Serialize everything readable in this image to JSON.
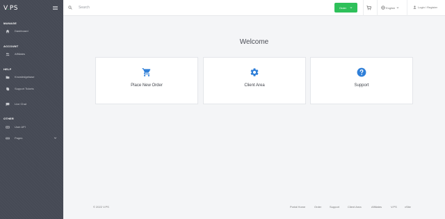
{
  "brand": {
    "logo_v": "V",
    "logo_dot": ".",
    "logo_ps": "PS"
  },
  "sidebar": {
    "sections": [
      {
        "title": "MANAGE",
        "items": [
          {
            "label": "Dashboard",
            "icon": "home-icon"
          }
        ]
      },
      {
        "title": "ACCOUNT",
        "items": [
          {
            "label": "Affiliates",
            "icon": "users-icon"
          }
        ]
      },
      {
        "title": "HELP",
        "items": [
          {
            "label": "Knowledgebase",
            "icon": "folder-icon"
          },
          {
            "label": "Support Tickets",
            "icon": "tickets-icon"
          },
          {
            "label": "Live Chat",
            "icon": "chat-icon"
          }
        ]
      },
      {
        "title": "OTHER",
        "items": [
          {
            "label": "User API",
            "icon": "api-icon"
          },
          {
            "label": "Pages",
            "icon": "pages-icon"
          }
        ]
      }
    ]
  },
  "topbar": {
    "search_placeholder": "Search",
    "order_label": "Order",
    "language_label": "English",
    "login_label": "Login / Register"
  },
  "main": {
    "welcome": "Welcome",
    "cards": [
      {
        "label": "Place New Order",
        "icon": "cart-icon"
      },
      {
        "label": "Client Area",
        "icon": "gear-icon"
      },
      {
        "label": "Support",
        "icon": "help-icon"
      }
    ]
  },
  "footer": {
    "copyright": "© 2022 V.PS",
    "links": [
      "Portal Home",
      "Order",
      "Support",
      "Client Area",
      "Affiliates",
      "V.PS",
      "vSite"
    ]
  },
  "colors": {
    "sidebar_bg": "#464a55",
    "accent_green": "#2ec05a",
    "icon_blue": "#2f7fd8"
  }
}
